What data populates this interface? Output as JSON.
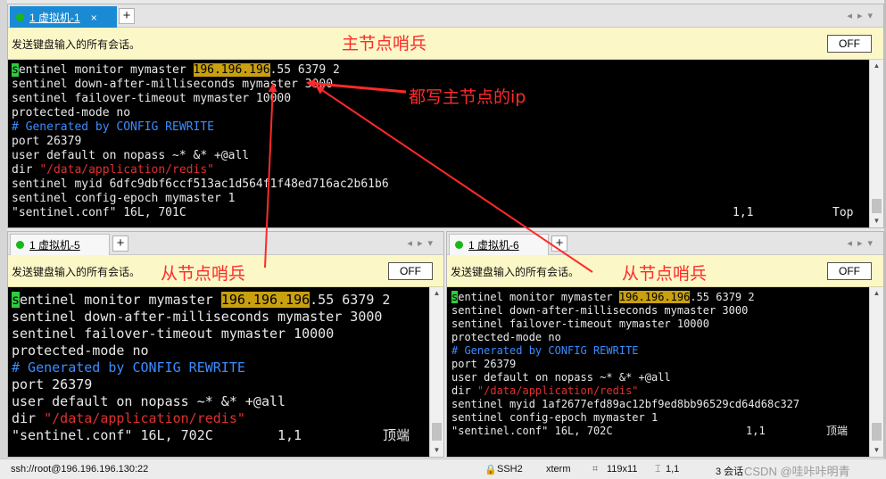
{
  "tabs": {
    "top": {
      "label": "1 虚拟机-1",
      "close": "×",
      "add": "+"
    },
    "bottom_left": {
      "label": "1 虚拟机-5",
      "add": "+"
    },
    "bottom_right": {
      "label": "1 虚拟机-6",
      "add": "+"
    }
  },
  "notice": {
    "text": "发送键盘输入的所有会话。",
    "off_label": "OFF"
  },
  "annotations": {
    "master": "主节点哨兵",
    "ip_note": "都写主节点的ip",
    "slave_left": "从节点哨兵",
    "slave_right": "从节点哨兵"
  },
  "terminal_top": {
    "cursor_char": "s",
    "l1_rest": "entinel monitor mymaster ",
    "l1_ip": "196.196.196",
    "l1_tail": ".55 6379 2",
    "l2": "sentinel down-after-milliseconds mymaster 3000",
    "l3": "sentinel failover-timeout mymaster 10000",
    "l4": "protected-mode no",
    "l5": "# Generated by CONFIG REWRITE",
    "l6": "port 26379",
    "l7": "user default on nopass ~* &* +@all",
    "l8_pre": "dir ",
    "l8_path": "\"/data/application/redis\"",
    "l9": "sentinel myid 6dfc9dbf6ccf513ac1d564f1f48ed716ac2b61b6",
    "l10": "sentinel config-epoch mymaster 1",
    "status_file": "\"sentinel.conf\" 16L, 701C",
    "status_pos": "1,1",
    "status_scroll": "Top"
  },
  "terminal_left": {
    "cursor_char": "s",
    "l1_rest": "entinel monitor mymaster ",
    "l1_ip": "196.196.196",
    "l1_tail": ".55 6379 2",
    "l2": "sentinel down-after-milliseconds mymaster 3000",
    "l3": "sentinel failover-timeout mymaster 10000",
    "l4": "protected-mode no",
    "l5": "# Generated by CONFIG REWRITE",
    "l6": "port 26379",
    "l7": "user default on nopass ~* &* +@all",
    "l8_pre": "dir ",
    "l8_path": "\"/data/application/redis\"",
    "status_file": "\"sentinel.conf\" 16L, 702C",
    "status_pos": "1,1",
    "status_scroll": "顶端"
  },
  "terminal_right": {
    "cursor_char": "s",
    "l1_rest": "entinel monitor mymaster ",
    "l1_ip": "196.196.196",
    "l1_tail": ".55 6379 2",
    "l2": "sentinel down-after-milliseconds mymaster 3000",
    "l3": "sentinel failover-timeout mymaster 10000",
    "l4": "protected-mode no",
    "l5": "# Generated by CONFIG REWRITE",
    "l6": "port 26379",
    "l7": "user default on nopass ~* &* +@all",
    "l8_pre": "dir ",
    "l8_path": "\"/data/application/redis\"",
    "l9": "sentinel myid 1af2677efd89ac12bf9ed8bb96529cd64d68c327",
    "l10": "sentinel config-epoch mymaster 1",
    "status_file": "\"sentinel.conf\" 16L, 702C",
    "status_pos": "1,1",
    "status_scroll": "顶端"
  },
  "statusbar": {
    "connection": "ssh://root@196.196.196.130:22",
    "protocol": "SSH2",
    "term_type": "xterm",
    "size": "119x11",
    "cursor": "1,1",
    "sessions": "3 会话",
    "watermark": "CSDN @哇咔咔明青"
  },
  "colors": {
    "accent_tab": "#1a8ad4",
    "highlight": "#c8a010",
    "annotation": "#ff2a2a",
    "comment": "#3c8cff",
    "path": "#e03030"
  }
}
